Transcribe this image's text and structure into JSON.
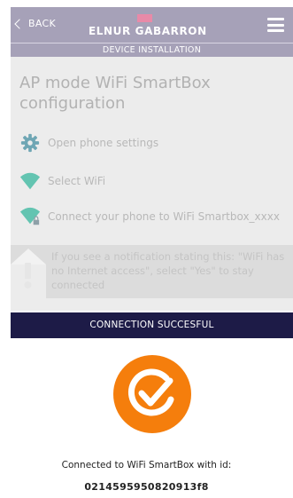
{
  "header": {
    "back_label": "BACK",
    "brand": "ELNUR GABARRON",
    "subtitle": "DEVICE INSTALLATION",
    "background": "#a6a1b8"
  },
  "page": {
    "title": "AP mode WiFi SmartBox configuration"
  },
  "steps": [
    {
      "label": "Open phone settings",
      "icon": "gear-icon"
    },
    {
      "label": "Select WiFi",
      "icon": "wifi-icon"
    },
    {
      "label": "Connect your phone to WiFi Smartbox_xxxx",
      "icon": "wifi-lock-icon"
    }
  ],
  "notice": {
    "text": "If you see a notification stating this: \"WiFi has no Internet access\", select \"Yes\" to stay connected",
    "icon": "warning-icon"
  },
  "banner": {
    "text": "CONNECTION SUCCESFUL",
    "background": "#1d1b47"
  },
  "result": {
    "icon": "check-circle-icon",
    "accent": "#f57e0c",
    "label": "Connected to WiFi SmartBox with id:",
    "device_id": "0214595950820913f8"
  }
}
